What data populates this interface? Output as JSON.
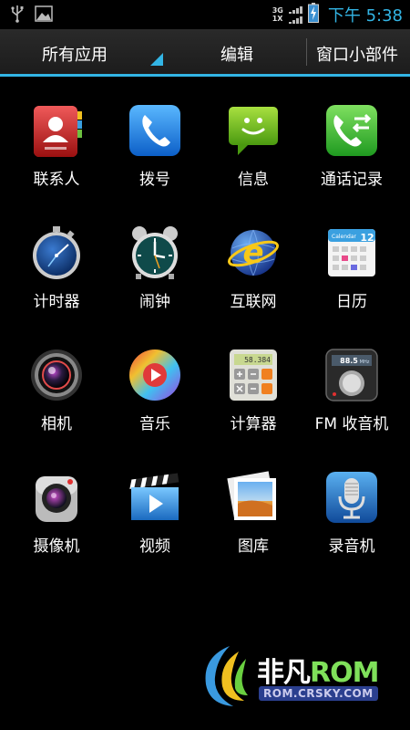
{
  "status_bar": {
    "net_top": "3G",
    "net_bottom": "1X",
    "time": "下午 5:38",
    "left_icons": [
      "usb-icon",
      "image-icon"
    ]
  },
  "tabs": {
    "all_apps": "所有应用",
    "edit": "编辑",
    "widgets": "窗口小部件"
  },
  "apps": [
    {
      "label": "联系人",
      "icon": "contacts-icon"
    },
    {
      "label": "拨号",
      "icon": "phone-icon"
    },
    {
      "label": "信息",
      "icon": "messages-icon"
    },
    {
      "label": "通话记录",
      "icon": "call-log-icon"
    },
    {
      "label": "计时器",
      "icon": "stopwatch-icon"
    },
    {
      "label": "闹钟",
      "icon": "alarm-clock-icon"
    },
    {
      "label": "互联网",
      "icon": "browser-icon"
    },
    {
      "label": "日历",
      "icon": "calendar-icon"
    },
    {
      "label": "相机",
      "icon": "camera-icon"
    },
    {
      "label": "音乐",
      "icon": "music-icon"
    },
    {
      "label": "计算器",
      "icon": "calculator-icon"
    },
    {
      "label": "FM 收音机",
      "icon": "fm-radio-icon"
    },
    {
      "label": "摄像机",
      "icon": "camcorder-icon"
    },
    {
      "label": "视频",
      "icon": "video-icon"
    },
    {
      "label": "图库",
      "icon": "gallery-icon"
    },
    {
      "label": "录音机",
      "icon": "recorder-icon"
    }
  ],
  "icon_text": {
    "calculator_display": "58.384",
    "calendar_header": "Calendar",
    "calendar_day": "12",
    "radio_freq": "88.5",
    "radio_unit": "MHz"
  },
  "watermark": {
    "brand_cn": "非凡",
    "brand_rom": "ROM",
    "url": "ROM.CRSKY.COM"
  },
  "colors": {
    "accent": "#33b5e5",
    "background": "#000000"
  }
}
